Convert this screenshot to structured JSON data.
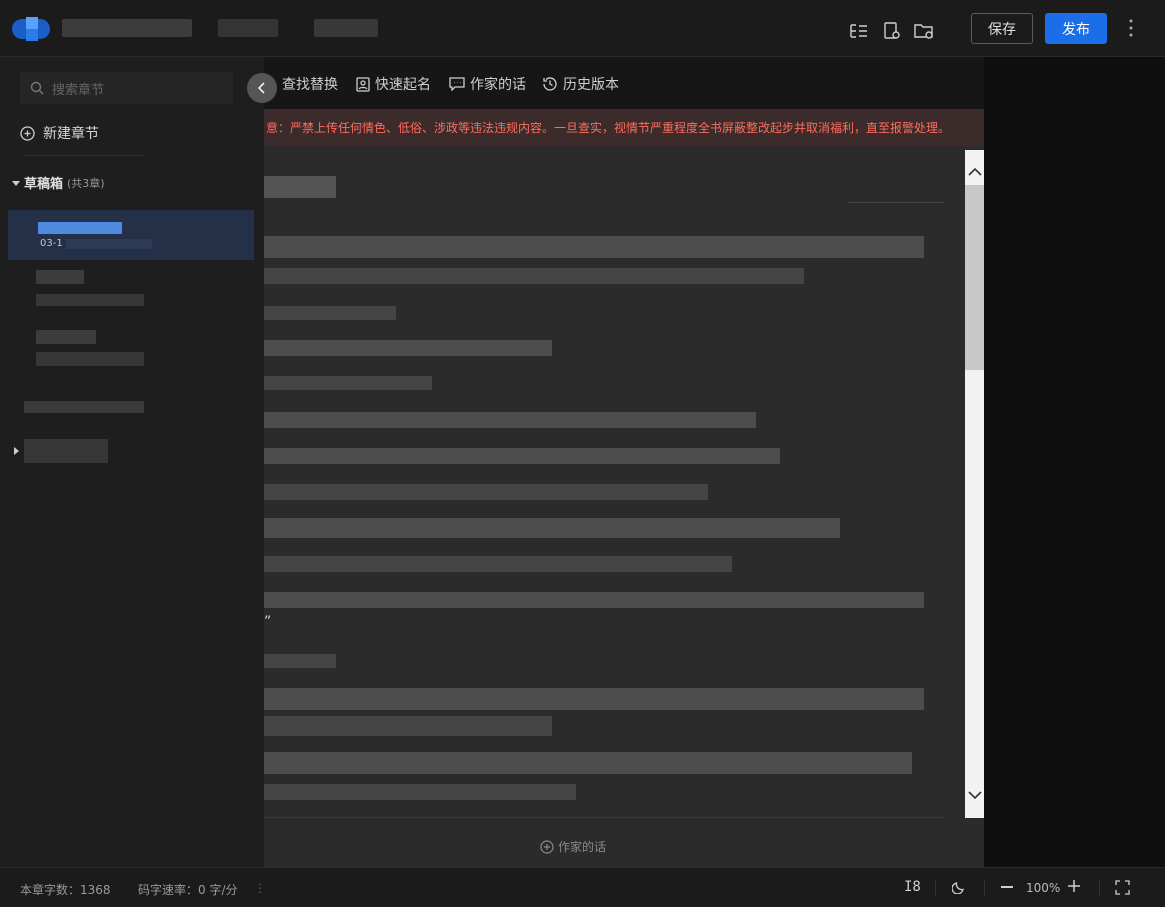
{
  "topbar": {
    "save_label": "保存",
    "publish_label": "发布",
    "accent_color": "#1a6fe8"
  },
  "sidebar": {
    "search_placeholder": "搜索章节",
    "new_chapter_label": "新建章节",
    "drafts_title": "草稿箱",
    "drafts_count": "(共3章)",
    "active_item_date_prefix": "03-1"
  },
  "toolbar": {
    "items": [
      {
        "label": "查找替换",
        "icon": "find-replace-icon"
      },
      {
        "label": "快速起名",
        "icon": "quick-name-icon"
      },
      {
        "label": "作家的话",
        "icon": "message-icon"
      },
      {
        "label": "历史版本",
        "icon": "history-icon"
      }
    ]
  },
  "notice": {
    "text": "意：严禁上传任何情色、低俗、涉政等违法违规内容。一旦查实，视情节严重程度全书屏蔽整改起步并取消福利，直至报警处理。",
    "color": "#ff6b5e"
  },
  "editor": {
    "footer_label": "作家的话",
    "stray_quote": "”"
  },
  "statusbar": {
    "word_count_label": "本章字数：1368",
    "typing_speed_label": "码字速率：0 字/分",
    "zoom_label": "100%",
    "layout_label": "I8"
  }
}
